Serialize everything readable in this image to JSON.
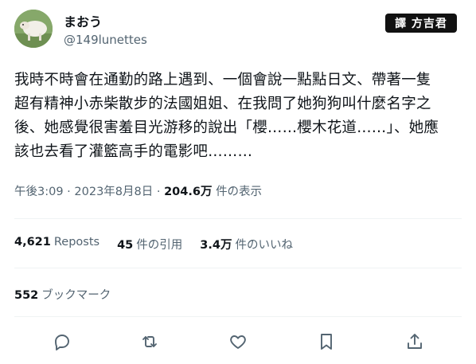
{
  "user": {
    "display_name": "まおう",
    "handle": "@149lunettes"
  },
  "watermark": "譯 方吉君",
  "tweet": {
    "lines": [
      "我時不時會在通勤的路上遇到、一個會說一點點日文、帶著一隻",
      "超有精神小赤柴散步的法國姐姐、在我問了她狗狗叫什麼名字之",
      "後、她感覺很害羞目光游移的說出「櫻……櫻木花道……」、她應",
      "該也去看了灌籃高手的電影吧………"
    ]
  },
  "meta": {
    "time": "午後3:09",
    "separator": "·",
    "date": "2023年8月8日",
    "views": "204.6万",
    "views_label": "件の表示"
  },
  "stats": {
    "reposts_count": "4,621",
    "reposts_label": "Reposts",
    "quotes_count": "45",
    "quotes_label": "件の引用",
    "likes_count": "3.4万",
    "likes_label": "件のいいね"
  },
  "bookmarks": {
    "count": "552",
    "label": "ブックマーク"
  },
  "icons": {
    "reply": "reply-icon",
    "repost": "repost-icon",
    "like": "like-icon",
    "bookmark": "bookmark-icon",
    "share": "share-icon"
  }
}
